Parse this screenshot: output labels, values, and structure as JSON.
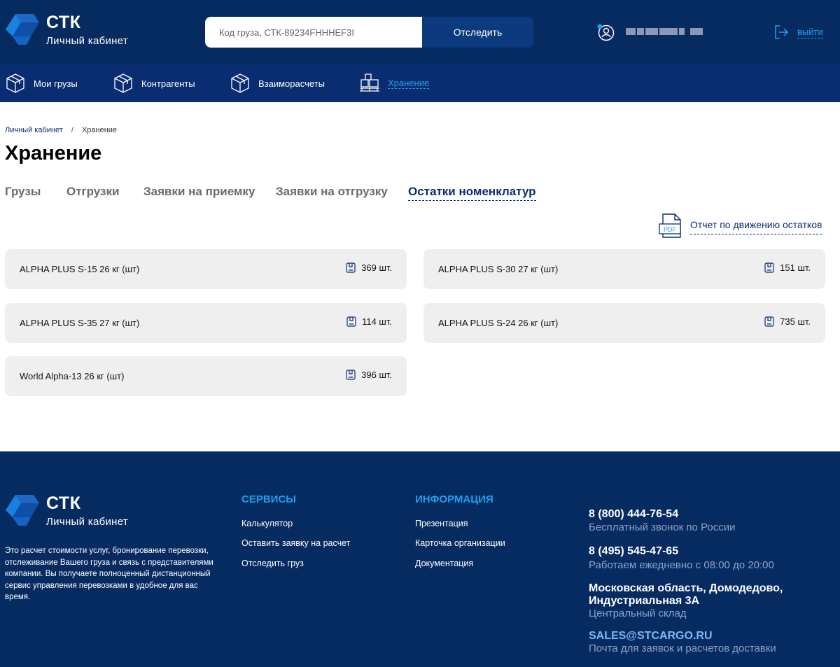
{
  "header": {
    "brand": "СТК",
    "brand_sub": "Личный кабинет",
    "search_placeholder": "Код груза, СТК-89234FHHHEF3I",
    "track_label": "Отследить",
    "logout_label": "выйти"
  },
  "nav": {
    "items": [
      {
        "label": "Мои грузы"
      },
      {
        "label": "Контрагенты"
      },
      {
        "label": "Взаиморасчеты"
      },
      {
        "label": "Хранение",
        "active": true
      }
    ]
  },
  "breadcrumb": {
    "root": "Личный кабинет",
    "separator": "/",
    "current": "Хранение"
  },
  "page": {
    "title": "Хранение"
  },
  "tabs": [
    {
      "label": "Грузы"
    },
    {
      "label": "Отгрузки"
    },
    {
      "label": "Заявки на приемку"
    },
    {
      "label": "Заявки на отгрузку"
    },
    {
      "label": "Остатки номенклатур",
      "active": true
    }
  ],
  "report": {
    "label": "Отчет по движению остатков",
    "icon_text": "PDF"
  },
  "stock_items": [
    {
      "name": "ALPHA PLUS S-15 26 кг (шт)",
      "qty": "369 шт."
    },
    {
      "name": "ALPHA PLUS S-30 27 кг (шт)",
      "qty": "151 шт."
    },
    {
      "name": "ALPHA PLUS S-35 27 кг (шт)",
      "qty": "114 шт."
    },
    {
      "name": "ALPHA PLUS S-24 26 кг (шт)",
      "qty": "735 шт."
    },
    {
      "name": "World Alpha-13 26 кг (шт)",
      "qty": "396 шт."
    }
  ],
  "footer": {
    "brand": "СТК",
    "brand_sub": "Личный кабинет",
    "description": "Это расчет стоимости услуг, бронирование перевозки, отслеживание Вашего груза и связь с представителями компании. Вы получаете полноценный дистанционный сервис управления перевозками в удобное для вас время.",
    "services": {
      "title": "Сервисы",
      "links": [
        "Калькулятор",
        "Оставить заявку на расчет",
        "Отследить груз"
      ]
    },
    "info": {
      "title": "Информация",
      "links": [
        "Презентация",
        "Карточка организации",
        "Документация"
      ]
    },
    "contacts": {
      "phone1": "8 (800) 444-76-54",
      "phone1_note": "Бесплатный звонок по России",
      "phone2": "8 (495) 545-47-65",
      "phone2_note": "Работаем ежедневно с 08:00 до 20:00",
      "address_line1": "Московская область, Домодедово,",
      "address_line2": "Индустриальная 3А",
      "address_note": "Центральный склад",
      "email": "SALES@STCARGO.RU",
      "email_note": "Почта для заявок и расчетов доставки"
    }
  },
  "colors": {
    "header_bg": "#062b61",
    "nav_bg": "#0a2d71",
    "accent": "#1ea0ef",
    "card_bg": "#efefef"
  }
}
